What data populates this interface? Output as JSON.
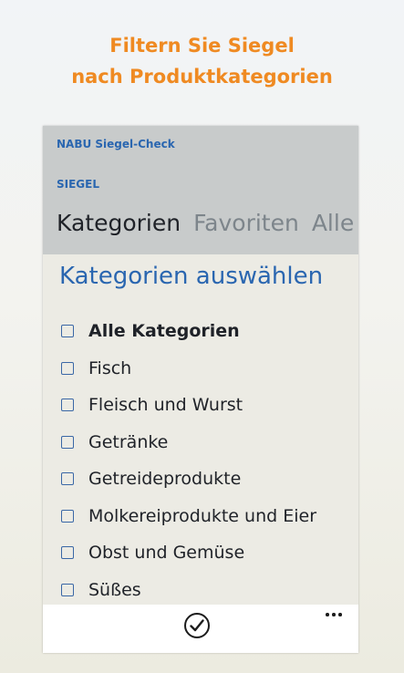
{
  "promo": {
    "line1": "Filtern Sie Siegel",
    "line2": "nach Produktkategorien"
  },
  "app": {
    "name": "NABU Siegel-Check",
    "section": "SIEGEL"
  },
  "pivot": {
    "tabs": [
      "Kategorien",
      "Favoriten",
      "Alle"
    ],
    "active": "Kategorien"
  },
  "content": {
    "title": "Kategorien auswählen",
    "items": [
      {
        "label": "Alle Kategorien",
        "checked": false
      },
      {
        "label": "Fisch",
        "checked": false
      },
      {
        "label": "Fleisch und Wurst",
        "checked": false
      },
      {
        "label": "Getränke",
        "checked": false
      },
      {
        "label": "Getreideprodukte",
        "checked": false
      },
      {
        "label": "Molkereiprodukte und Eier",
        "checked": false
      },
      {
        "label": "Obst und Gemüse",
        "checked": false
      },
      {
        "label": "Süßes",
        "checked": false
      }
    ]
  },
  "appbar": {
    "confirm_icon": "checkmark-circle-icon",
    "more_icon": "more-dots-icon"
  },
  "colors": {
    "accent_orange": "#ef8a22",
    "accent_blue": "#2a66b0",
    "header_bg": "#c8cbcb"
  }
}
